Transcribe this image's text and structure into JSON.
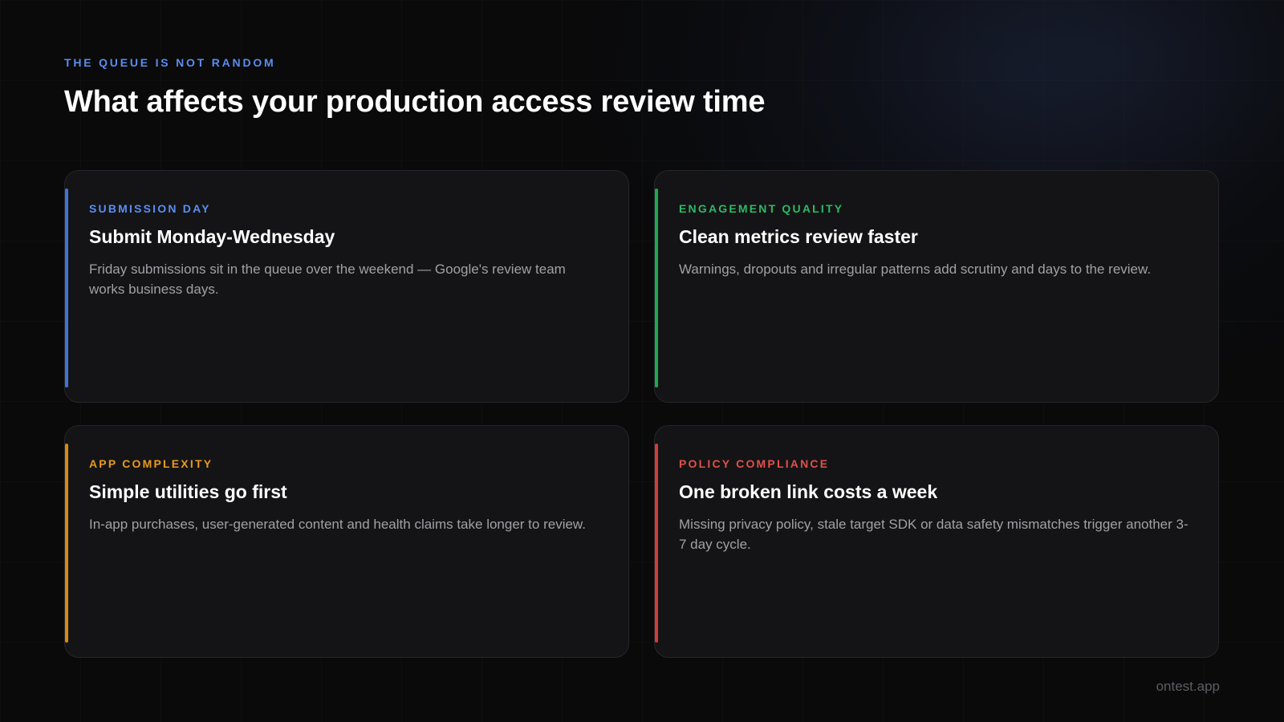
{
  "header": {
    "eyebrow": "THE QUEUE IS NOT RANDOM",
    "title": "What affects your production access review time"
  },
  "cards": [
    {
      "label": "SUBMISSION DAY",
      "title": "Submit Monday-Wednesday",
      "description": "Friday submissions sit in the queue over the weekend — Google's review team works business days.",
      "accent_color": "#3f74d6"
    },
    {
      "label": "ENGAGEMENT QUALITY",
      "title": "Clean metrics review faster",
      "description": "Warnings, dropouts and irregular patterns add scrutiny and days to the review.",
      "accent_color": "#1fa653"
    },
    {
      "label": "APP COMPLEXITY",
      "title": "Simple utilities go first",
      "description": "In-app purchases, user-generated content and health claims take longer to review.",
      "accent_color": "#d98a12"
    },
    {
      "label": "POLICY COMPLIANCE",
      "title": "One broken link costs a week",
      "description": "Missing privacy policy, stale target SDK or data safety mismatches trigger another 3-7 day cycle.",
      "accent_color": "#cf3d3a"
    }
  ],
  "footer": {
    "brand": "ontest.app"
  },
  "colors": {
    "background": "#0a0a0b",
    "card_background": "#141416",
    "eyebrow": "#5b8def",
    "text_primary": "#ffffff",
    "text_secondary": "#a0a0a6",
    "footer_text": "#5e5e63"
  }
}
